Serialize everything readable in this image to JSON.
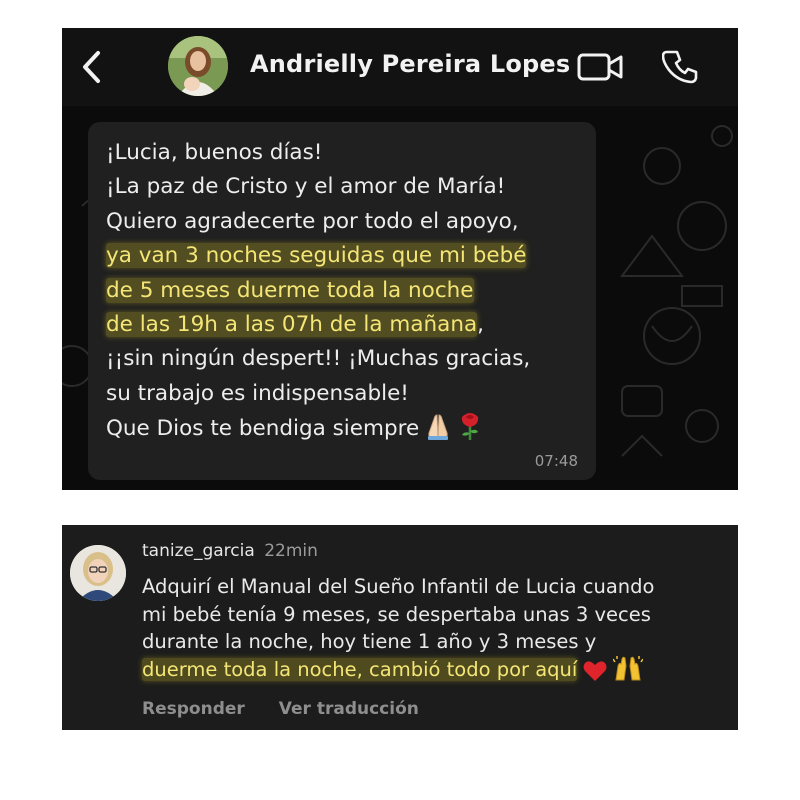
{
  "whatsapp": {
    "contact_name": "Andrielly Pereira Lopes",
    "icons": {
      "back": "chevron-left-icon",
      "avatar": "contact-avatar",
      "video": "video-call-icon",
      "call": "phone-call-icon"
    },
    "message": {
      "lines": [
        "¡Lucia, buenos días!",
        "¡La paz de Cristo y el amor de María!",
        "Quiero agradecerte por todo el apoyo,",
        "ya van 3 noches seguidas que mi bebé",
        "de 5 meses duerme toda la noche",
        "de las 19h a las 07h de la mañana",
        ",",
        "¡¡sin ningún despert!! ¡Muchas gracias,",
        "su trabajo es indispensable!",
        "Que Dios te bendiga siempre"
      ],
      "emojis": [
        "folded-hands-emoji",
        "rose-emoji"
      ],
      "time": "07:48"
    },
    "colors": {
      "header_bg": "#121212",
      "chat_bg": "#0b0b0b",
      "bubble_bg": "#202020",
      "highlight": "#f4e676"
    }
  },
  "instagram_comment": {
    "username": "tanize_garcia",
    "time_ago": "22min",
    "lines": [
      "Adquirí el Manual del Sueño Infantil de Lucia cuando",
      "mi bebé tenía 9 meses, se despertaba unas 3 veces",
      "durante la noche, hoy tiene 1 año y 3 meses y",
      "duerme toda la noche, cambió todo por aquí"
    ],
    "emojis": [
      "red-heart-emoji",
      "raised-hands-emoji"
    ],
    "actions": {
      "reply": "Responder",
      "translate": "Ver traducción"
    },
    "colors": {
      "card_bg": "#1c1c1c",
      "action_text": "#8e8e8e"
    }
  }
}
